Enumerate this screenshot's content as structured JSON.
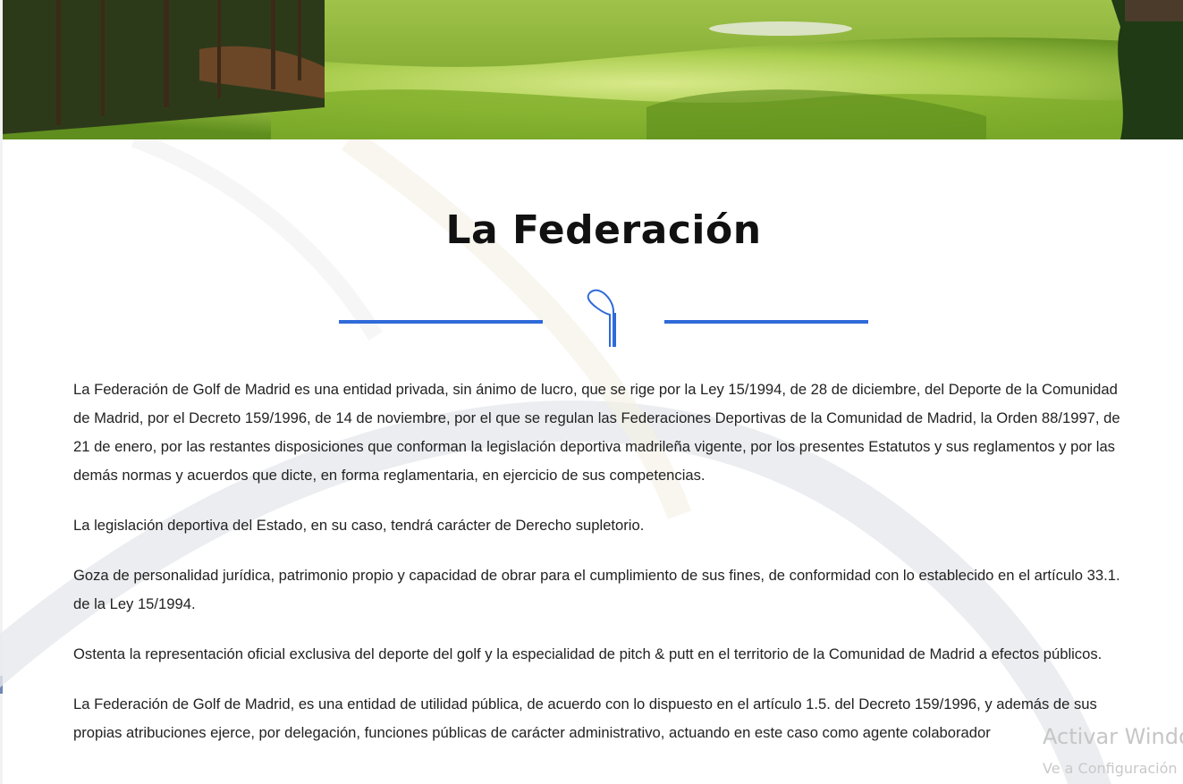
{
  "hero": {
    "image": "golf-course-fairway-photo"
  },
  "page": {
    "title": "La Federación"
  },
  "divider": {
    "icon": "golf-club-icon",
    "color": "#2f6ad8"
  },
  "paragraphs": [
    "La Federación de Golf de Madrid es una entidad privada, sin ánimo de lucro, que se rige por la Ley 15/1994, de 28 de diciembre, del Deporte de la Comunidad de Madrid, por el Decreto 159/1996, de 14 de noviembre, por el que se regulan las Federaciones Deportivas de la Comunidad de Madrid, la Orden 88/1997, de 21 de enero, por las restantes disposiciones que conforman la legislación deportiva madrileña vigente, por los presentes Estatutos y sus reglamentos y por las demás normas y acuerdos que dicte, en forma reglamentaria, en ejercicio de sus competencias.",
    "La legislación deportiva del Estado, en su caso, tendrá carácter de Derecho supletorio.",
    "Goza de personalidad jurídica, patrimonio propio y capacidad de obrar para el cumplimiento de sus fines, de conformidad con lo establecido en el artículo 33.1. de la Ley 15/1994.",
    "Ostenta la representación oficial exclusiva del deporte del golf  y la especialidad de pitch & putt en el territorio de la Comunidad de Madrid a efectos públicos.",
    "La Federación de Golf de Madrid, es una entidad de utilidad pública, de acuerdo con lo dispuesto en el artículo 1.5. del Decreto 159/1996, y además de sus propias atribuciones ejerce, por delegación, funciones públicas de carácter administrativo, actuando en este caso como agente colaborador"
  ],
  "os_overlay": {
    "activate_text": "Activar Windows",
    "settings_text": "Ve a Configuración"
  }
}
